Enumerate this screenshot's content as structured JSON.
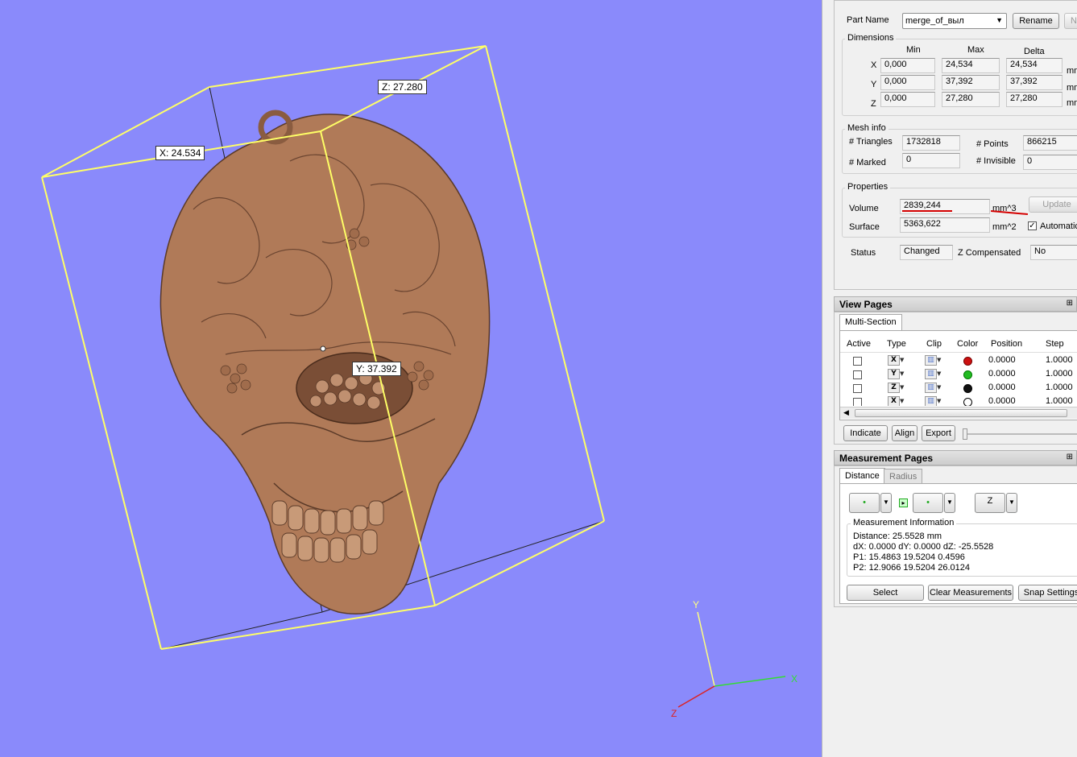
{
  "viewport": {
    "labels": {
      "x": "X: 24.534",
      "y": "Y: 37.392",
      "z": "Z: 27.280"
    },
    "axes": {
      "x": "X",
      "y": "Y",
      "z": "Z"
    },
    "background_color": "#8a8afb",
    "bbox_color": "#ffff66",
    "model_color": "#b08060"
  },
  "part": {
    "label": "Part Name",
    "name": "merge_of_выл",
    "rename_label": "Rename",
    "next_label": "Ne"
  },
  "dimensions": {
    "title": "Dimensions",
    "headers": {
      "min": "Min",
      "max": "Max",
      "delta": "Delta"
    },
    "rows": [
      {
        "axis": "X",
        "min": "0,000",
        "max": "24,534",
        "delta": "24,534",
        "unit": "mm"
      },
      {
        "axis": "Y",
        "min": "0,000",
        "max": "37,392",
        "delta": "37,392",
        "unit": "mm"
      },
      {
        "axis": "Z",
        "min": "0,000",
        "max": "27,280",
        "delta": "27,280",
        "unit": "mm"
      }
    ]
  },
  "mesh": {
    "title": "Mesh info",
    "triangles_label": "# Triangles",
    "triangles": "1732818",
    "points_label": "# Points",
    "points": "866215",
    "marked_label": "# Marked",
    "marked": "0",
    "invisible_label": "# Invisible",
    "invisible": "0"
  },
  "properties": {
    "title": "Properties",
    "volume_label": "Volume",
    "volume": "2839,244",
    "volume_unit": "mm^3",
    "update_label": "Update",
    "surface_label": "Surface",
    "surface": "5363,622",
    "surface_unit": "mm^2",
    "automatic_label": "Automatic",
    "automatic_checked": true
  },
  "status": {
    "label": "Status",
    "value": "Changed",
    "zcomp_label": "Z Compensated",
    "zcomp_value": "No"
  },
  "view_pages": {
    "title": "View Pages",
    "tab": "Multi-Section",
    "headers": [
      "Active",
      "Type",
      "Clip",
      "Color",
      "Position",
      "Step"
    ],
    "rows": [
      {
        "type": "X",
        "color": "#cc1010",
        "position": "0.0000",
        "step": "1.0000"
      },
      {
        "type": "Y",
        "color": "#22bb22",
        "position": "0.0000",
        "step": "1.0000"
      },
      {
        "type": "Z",
        "color": "#111111",
        "position": "0.0000",
        "step": "1.0000"
      },
      {
        "type": "X",
        "color": "#ffffff",
        "position": "0.0000",
        "step": "1.0000"
      }
    ],
    "buttons": {
      "indicate": "Indicate",
      "align": "Align",
      "export": "Export"
    }
  },
  "measurement_pages": {
    "title": "Measurement Pages",
    "tabs": {
      "distance": "Distance",
      "radius": "Radius"
    },
    "axis_button": "Z",
    "info_title": "Measurement Information",
    "lines": [
      "Distance: 25.5528 mm",
      "dX: 0.0000 dY: 0.0000 dZ: -25.5528",
      "P1: 15.4863  19.5204  0.4596",
      "P2: 12.9066  19.5204  26.0124"
    ],
    "buttons": {
      "select": "Select",
      "clear": "Clear Measurements",
      "snap": "Snap Settings"
    }
  }
}
